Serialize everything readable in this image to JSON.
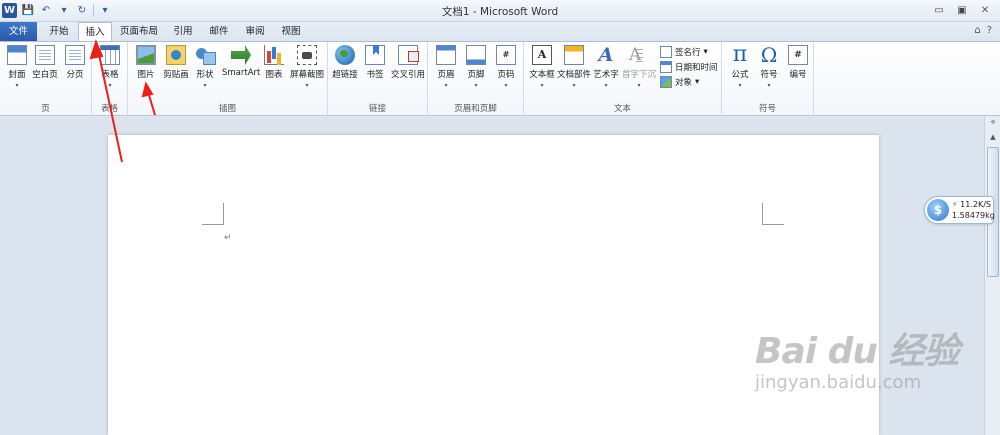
{
  "window": {
    "title": "文档1 - Microsoft Word",
    "min_glyph": "▭",
    "max_glyph": "▣",
    "close_glyph": "✕"
  },
  "qat": {
    "logo": "W",
    "save_glyph": "💾",
    "undo_glyph": "↶",
    "redo_glyph": "↻",
    "more_glyph": "▾"
  },
  "tabs": {
    "file": "文件",
    "home": "开始",
    "insert": "插入",
    "page_layout": "页面布局",
    "references": "引用",
    "mailings": "邮件",
    "review": "审阅",
    "view": "视图"
  },
  "tabrow_right": {
    "collapse_glyph": "⌂",
    "help_glyph": "?"
  },
  "ribbon": {
    "pages": {
      "label": "页",
      "cover": "封面",
      "blank": "空白页",
      "break": "分页"
    },
    "tables": {
      "label": "表格",
      "table": "表格"
    },
    "illustrations": {
      "label": "插图",
      "picture": "图片",
      "clipart": "剪贴画",
      "shapes": "形状",
      "smartart": "SmartArt",
      "chart": "图表",
      "screenshot": "屏幕截图"
    },
    "links": {
      "label": "链接",
      "hyperlink": "超链接",
      "bookmark": "书签",
      "crossref": "交叉引用"
    },
    "header_footer": {
      "label": "页眉和页脚",
      "header": "页眉",
      "footer": "页脚",
      "page_number": "页码"
    },
    "text": {
      "label": "文本",
      "textbox": "文本框",
      "quickparts": "文档部件",
      "wordart": "艺术字",
      "dropcap": "首字下沉",
      "signature": "签名行",
      "datetime": "日期和时间",
      "object": "对象"
    },
    "symbols": {
      "label": "符号",
      "equation": "公式",
      "symbol": "符号",
      "numbering": "编号"
    },
    "dropdown_glyph": "▾"
  },
  "icons": {
    "textbox_glyph": "A",
    "wordart_glyph": "A",
    "dropcap_glyph": "A",
    "pi_glyph": "π",
    "omega_glyph": "Ω",
    "numbering_glyph": "#",
    "pagenum_glyph": "#"
  },
  "document": {
    "paragraph_mark": "↵"
  },
  "widget": {
    "coin_glyph": "$",
    "speed": "11.2K/S",
    "weight": "1.58479kg",
    "bolt_glyph": "⚡"
  },
  "watermark": {
    "main": "Bai du 经验",
    "sub": "jingyan.baidu.com"
  },
  "colors": {
    "file_tab": "#2a5aa8",
    "annotation_arrow": "#e8221b",
    "ribbon_bg": "#f3f6fa"
  }
}
